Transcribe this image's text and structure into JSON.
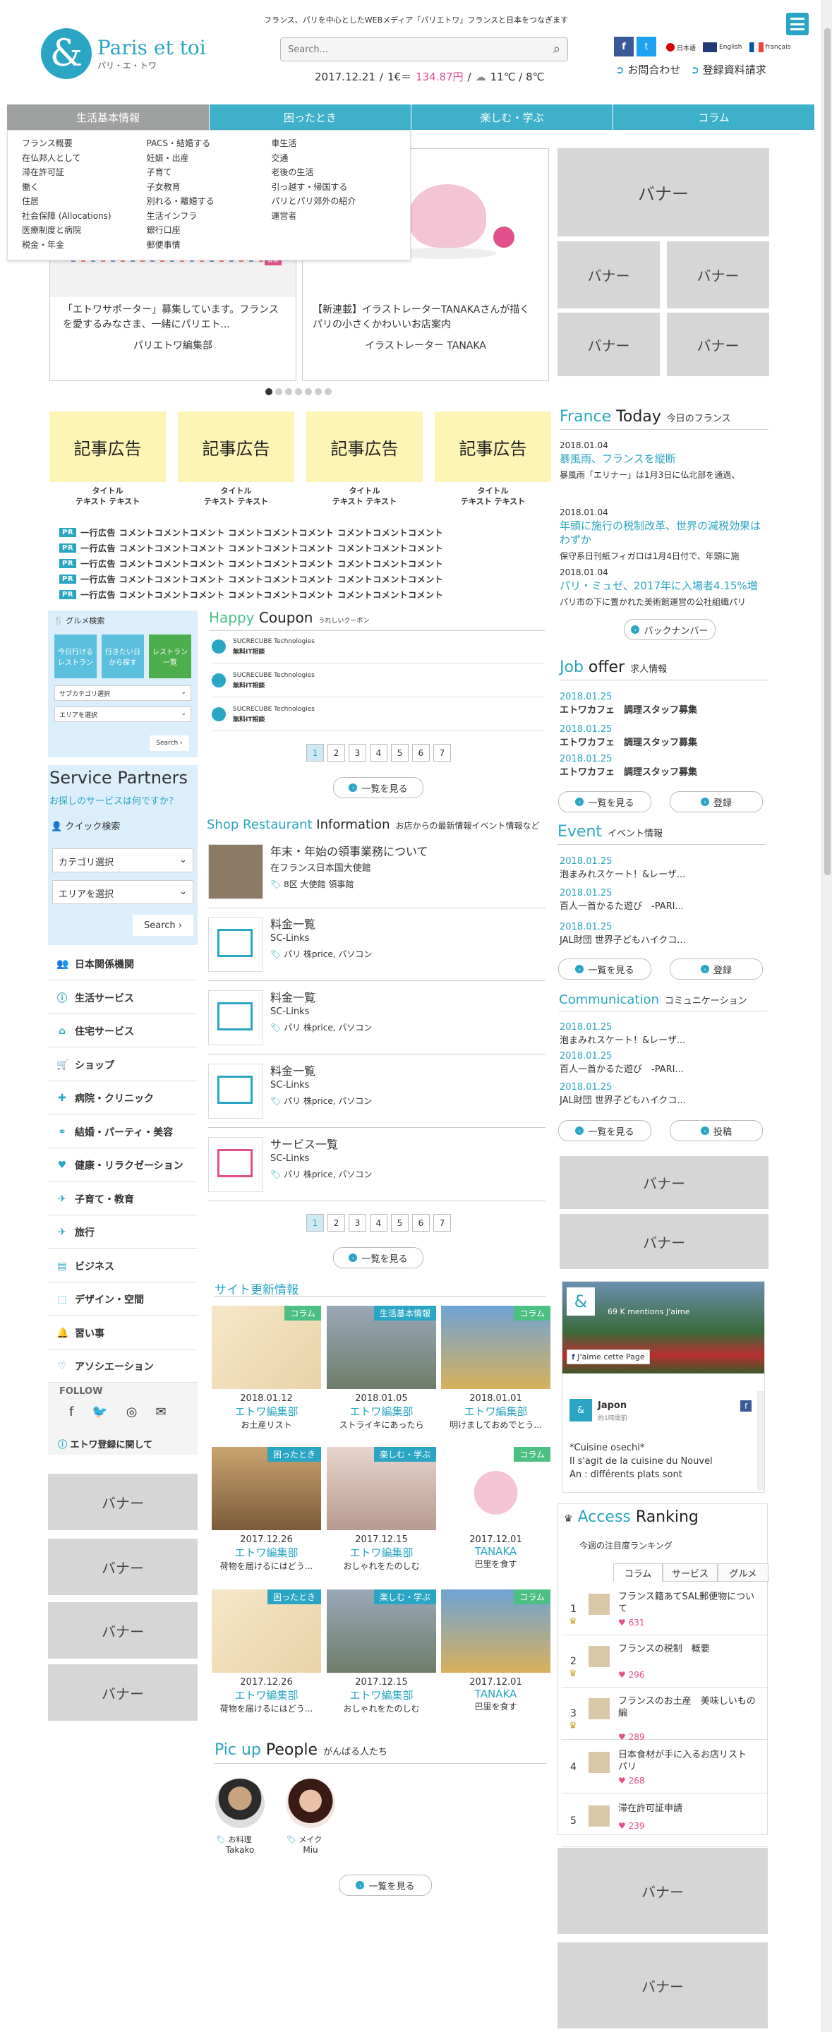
{
  "header": {
    "tagline": "フランス、パリを中心としたWEBメディア「パリエトワ」フランスと日本をつなぎます",
    "logo_main": "Paris et toi",
    "logo_sub": "パリ・エ・トワ",
    "search_placeholder": "Search...",
    "info_date": "2017.12.21",
    "info_rate_label": "1€＝",
    "info_rate": "134.87円",
    "info_weather": "11℃ / 8℃",
    "lang": [
      "日本語",
      "English",
      "français"
    ],
    "contact": "お問合わせ",
    "register": "登録資料請求"
  },
  "nav": {
    "tabs": [
      "生活基本情報",
      "困ったとき",
      "楽しむ・学ぶ",
      "コラム"
    ],
    "menu": [
      [
        "フランス概要",
        "在仏邦人として",
        "滞在許可証",
        "働く",
        "住居",
        "社会保障 (Allocations)",
        "医療制度と病院",
        "税金・年金"
      ],
      [
        "PACS・結婚する",
        "妊娠・出産",
        "子育て",
        "子女教育",
        "別れる・離婚する",
        "生活インフラ",
        "銀行口座",
        "郵便事情"
      ],
      [
        "車生活",
        "交通",
        "老後の生活",
        "引っ越す・帰国する",
        "パリとパリ郊外の紹介",
        "運営者"
      ]
    ]
  },
  "slider": {
    "slides": [
      {
        "title": "「エトワサポーター」募集しています。フランスを愛するみなさま、一緒にパリエト...",
        "author": "パリエトワ編集部"
      },
      {
        "title": "【新連載】イラストレーターTANAKAさんが描くパリの小さくかわいいお店案内",
        "author": "イラストレーター TANAKA"
      }
    ],
    "dots": 7,
    "banner_label": "バナー"
  },
  "ads": {
    "label": "記事広告",
    "caption1": "タイトル",
    "caption2": "テキスト テキスト",
    "pr_tag": "PR",
    "pr_text": "一行広告 コメントコメントコメント コメントコメントコメント コメントコメントコメント"
  },
  "gourmet": {
    "title": "グルメ検索",
    "btn": [
      "今日行ける\nレストラン",
      "行きたい日\nから探す",
      "レストラン\n一覧"
    ],
    "sel1": "サブカテゴリ選択",
    "sel2": "エリアを選択",
    "search": "Search"
  },
  "partners": {
    "title": "Service Partners",
    "sub": "お探しのサービスは何ですか？",
    "quick": "クイック検索",
    "sel1": "カテゴリ選択",
    "sel2": "エリアを選択",
    "search": "Search",
    "cats": [
      "日本関係機関",
      "生活サービス",
      "住宅サービス",
      "ショップ",
      "病院・クリニック",
      "結婚・パーティ・美容",
      "健康・リラクゼーション",
      "子育て・教育",
      "旅行",
      "ビジネス",
      "デザイン・空間",
      "習い事",
      "アソシエーション"
    ],
    "follow": "FOLLOW",
    "etowa_reg": "エトワ登録に関して"
  },
  "coupon": {
    "t1": "Happy",
    "t2": "Coupon",
    "sub": "うれしいクーポン",
    "items": [
      {
        "c": "SUCRECUBE Technologies",
        "d": "無料IT相談"
      },
      {
        "c": "SUCRECUBE Technologies",
        "d": "無料IT相談"
      },
      {
        "c": "SUCRECUBE Technologies",
        "d": "無料IT相談"
      }
    ],
    "pages": [
      "1",
      "2",
      "3",
      "4",
      "5",
      "6",
      "7"
    ],
    "more": "一覧を見る"
  },
  "shop": {
    "t1": "Shop Restaurant",
    "t2": "Information",
    "sub": "お店からの最新情報イベント情報など",
    "items": [
      {
        "h": "年末・年始の領事業務について",
        "s": "在フランス日本国大使館",
        "tag": "8区  大使館 領事館"
      },
      {
        "h": "料金一覧",
        "s": "SC-Links",
        "tag": "パリ  株price, パソコン"
      },
      {
        "h": "料金一覧",
        "s": "SC-Links",
        "tag": "パリ  株price, パソコン"
      },
      {
        "h": "料金一覧",
        "s": "SC-Links",
        "tag": "パリ  株price, パソコン"
      },
      {
        "h": "サービス一覧",
        "s": "SC-Links",
        "tag": "パリ  株price, パソコン"
      }
    ]
  },
  "site_update": {
    "title": "サイト更新情報",
    "cards": [
      {
        "tag": "コラム",
        "dt": "2018.01.12",
        "au": "エトワ編集部",
        "ds": "お土産リスト"
      },
      {
        "tag": "生活基本情報",
        "dt": "2018.01.05",
        "au": "エトワ編集部",
        "ds": "ストライキにあったら"
      },
      {
        "tag": "コラム",
        "dt": "2018.01.01",
        "au": "エトワ編集部",
        "ds": "明けましておめでとう..."
      },
      {
        "tag": "困ったとき",
        "dt": "2017.12.26",
        "au": "エトワ編集部",
        "ds": "荷物を届けるにはどう..."
      },
      {
        "tag": "楽しむ・学ぶ",
        "dt": "2017.12.15",
        "au": "エトワ編集部",
        "ds": "おしゃれをたのしむ"
      },
      {
        "tag": "コラム",
        "dt": "2017.12.01",
        "au": "TANAKA",
        "ds": "巴里を食す"
      },
      {
        "tag": "困ったとき",
        "dt": "2017.12.26",
        "au": "エトワ編集部",
        "ds": "荷物を届けるにはどう..."
      },
      {
        "tag": "楽しむ・学ぶ",
        "dt": "2017.12.15",
        "au": "エトワ編集部",
        "ds": "おしゃれをたのしむ"
      },
      {
        "tag": "コラム",
        "dt": "2017.12.01",
        "au": "TANAKA",
        "ds": "巴里を食す"
      }
    ]
  },
  "people": {
    "t1": "Pic up",
    "t2": "People",
    "sub": "がんばる人たち",
    "items": [
      {
        "c": "お料理",
        "n": "Takako"
      },
      {
        "c": "メイク",
        "n": "Miu"
      }
    ],
    "more": "一覧を見る"
  },
  "france_today": {
    "t1": "France",
    "t2": "Today",
    "sub": "今日のフランス",
    "items": [
      {
        "d": "2018.01.04",
        "h": "暴風雨、フランスを縦断",
        "s": "暴風雨「エリナー」は1月3日に仏北部を通過、"
      },
      {
        "d": "2018.01.04",
        "h": "年頭に施行の税制改革、世界の減税効果はわずか",
        "s": "保守系日刊紙フィガロは1月4日付で、年頭に施"
      },
      {
        "d": "2018.01.04",
        "h": "パリ・ミュゼ、2017年に入場者4.15%増",
        "s": "パリ市の下に置かれた美術館運営の公社組織パリ"
      }
    ],
    "backnumber": "バックナンバー"
  },
  "job": {
    "t1": "Job",
    "t2": "offer",
    "sub": "求人情報",
    "items": [
      {
        "d": "2018.01.25",
        "s": "エトワカフェ　調理スタッフ募集"
      },
      {
        "d": "2018.01.25",
        "s": "エトワカフェ　調理スタッフ募集"
      },
      {
        "d": "2018.01.25",
        "s": "エトワカフェ　調理スタッフ募集"
      }
    ],
    "more": "一覧を見る",
    "reg": "登録"
  },
  "event": {
    "t1": "Event",
    "sub": "イベント情報",
    "items": [
      {
        "d": "2018.01.25",
        "s": "泡まみれスケート！&レーザ..."
      },
      {
        "d": "2018.01.25",
        "s": "百人一首かるた遊び　-PARI..."
      },
      {
        "d": "2018.01.25",
        "s": "JAL財団 世界子どもハイクコ..."
      }
    ],
    "more": "一覧を見る",
    "reg": "登録"
  },
  "comm": {
    "t1": "Communication",
    "sub": "コミュニケーション",
    "items": [
      {
        "d": "2018.01.25",
        "s": "泡まみれスケート！&レーザ..."
      },
      {
        "d": "2018.01.25",
        "s": "百人一首かるた遊び　-PARI..."
      },
      {
        "d": "2018.01.25",
        "s": "JAL財団 世界子どもハイクコ..."
      }
    ],
    "more": "一覧を見る",
    "post": "投稿"
  },
  "facebook": {
    "likes": "69 K mentions J'aime",
    "like_btn": "J'aime cette Page",
    "post_name": "Japon",
    "post_time": "約1時間前",
    "post_text": [
      "*Cuisine osechi*",
      "Il s'agit de la cuisine du Nouvel",
      "An : différents plats sont"
    ]
  },
  "ranking": {
    "t1": "Access",
    "t2": "Ranking",
    "sub": "今週の注目度ランキング",
    "tabs": [
      "コラム",
      "サービス",
      "グルメ"
    ],
    "items": [
      {
        "n": "1",
        "t": "フランス籍あてSAL郵便物について",
        "h": "631"
      },
      {
        "n": "2",
        "t": "フランスの税制　概要",
        "h": "296"
      },
      {
        "n": "3",
        "t": "フランスのお土産　美味しいもの編",
        "h": "289"
      },
      {
        "n": "4",
        "t": "日本食材が手に入るお店リスト　パリ",
        "h": "268"
      },
      {
        "n": "5",
        "t": "滞在許可証申請",
        "h": "239"
      }
    ]
  },
  "colors": {
    "accent": "#2aa5c3",
    "nav": "#3fb0c9",
    "pink": "#e0508a",
    "yellow": "#fdf5b5"
  }
}
